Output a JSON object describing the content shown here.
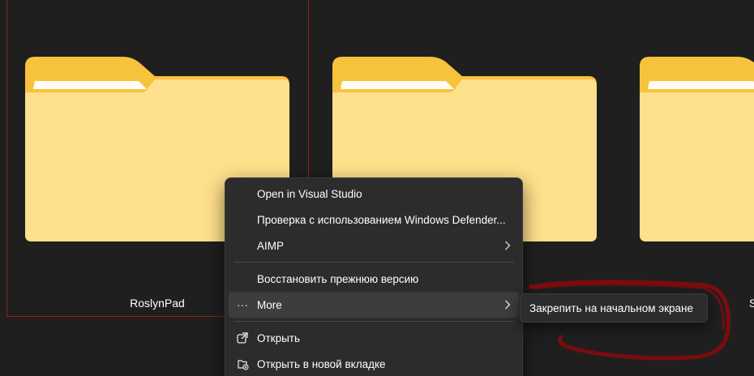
{
  "folders": [
    {
      "name": "RoslynPad"
    },
    {
      "name": ""
    },
    {
      "name": "S"
    }
  ],
  "context_menu": {
    "items": [
      {
        "label": "Open in Visual Studio"
      },
      {
        "label": "Проверка с использованием Windows Defender..."
      },
      {
        "label": "AIMP",
        "has_submenu": true
      },
      {
        "label": "Восстановить прежнюю версию"
      },
      {
        "label": "More",
        "lead_glyph": "···",
        "has_submenu": true
      },
      {
        "label": "Открыть",
        "icon": "open-external-icon"
      },
      {
        "label": "Открыть в новой вкладке",
        "icon": "new-tab-icon"
      }
    ]
  },
  "submenu": {
    "items": [
      {
        "label": "Закрепить на начальном экране"
      }
    ]
  },
  "colors": {
    "background": "#1f1f1f",
    "menu_bg": "#2c2c2c",
    "hover_bg": "#3d3d3d",
    "folder_back": "#f8c33c",
    "folder_front": "#ffe08c",
    "selection_border": "#9b1c1c",
    "annotation": "#7a0c10"
  }
}
